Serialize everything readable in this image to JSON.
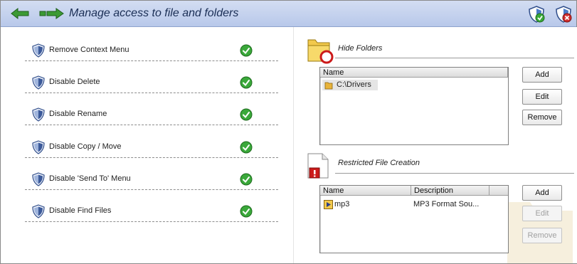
{
  "header": {
    "title": "Manage access to file and folders",
    "back_icon": "back-arrow-icon",
    "forward_icon": "forward-arrow-icon"
  },
  "options": [
    {
      "label": "Remove Context Menu",
      "enabled": true
    },
    {
      "label": "Disable Delete",
      "enabled": true
    },
    {
      "label": "Disable Rename",
      "enabled": true
    },
    {
      "label": "Disable Copy / Move",
      "enabled": true
    },
    {
      "label": "Disable 'Send To' Menu",
      "enabled": true
    },
    {
      "label": "Disable Find Files",
      "enabled": true
    }
  ],
  "hide_folders": {
    "title": "Hide Folders",
    "columns": [
      "Name"
    ],
    "rows": [
      {
        "name": "C:\\Drivers"
      }
    ],
    "buttons": {
      "add": "Add",
      "edit": "Edit",
      "remove": "Remove"
    }
  },
  "restricted": {
    "title": "Restricted File Creation",
    "columns": [
      "Name",
      "Description"
    ],
    "rows": [
      {
        "name": "mp3",
        "description": "MP3 Format Sou..."
      }
    ],
    "buttons": {
      "add": "Add",
      "edit": "Edit",
      "remove": "Remove"
    }
  },
  "colors": {
    "header_bg": "#c4d2ee",
    "title_text": "#1a2e55",
    "check_green": "#3aa83a",
    "shield_blue": "#3c5a9a"
  }
}
